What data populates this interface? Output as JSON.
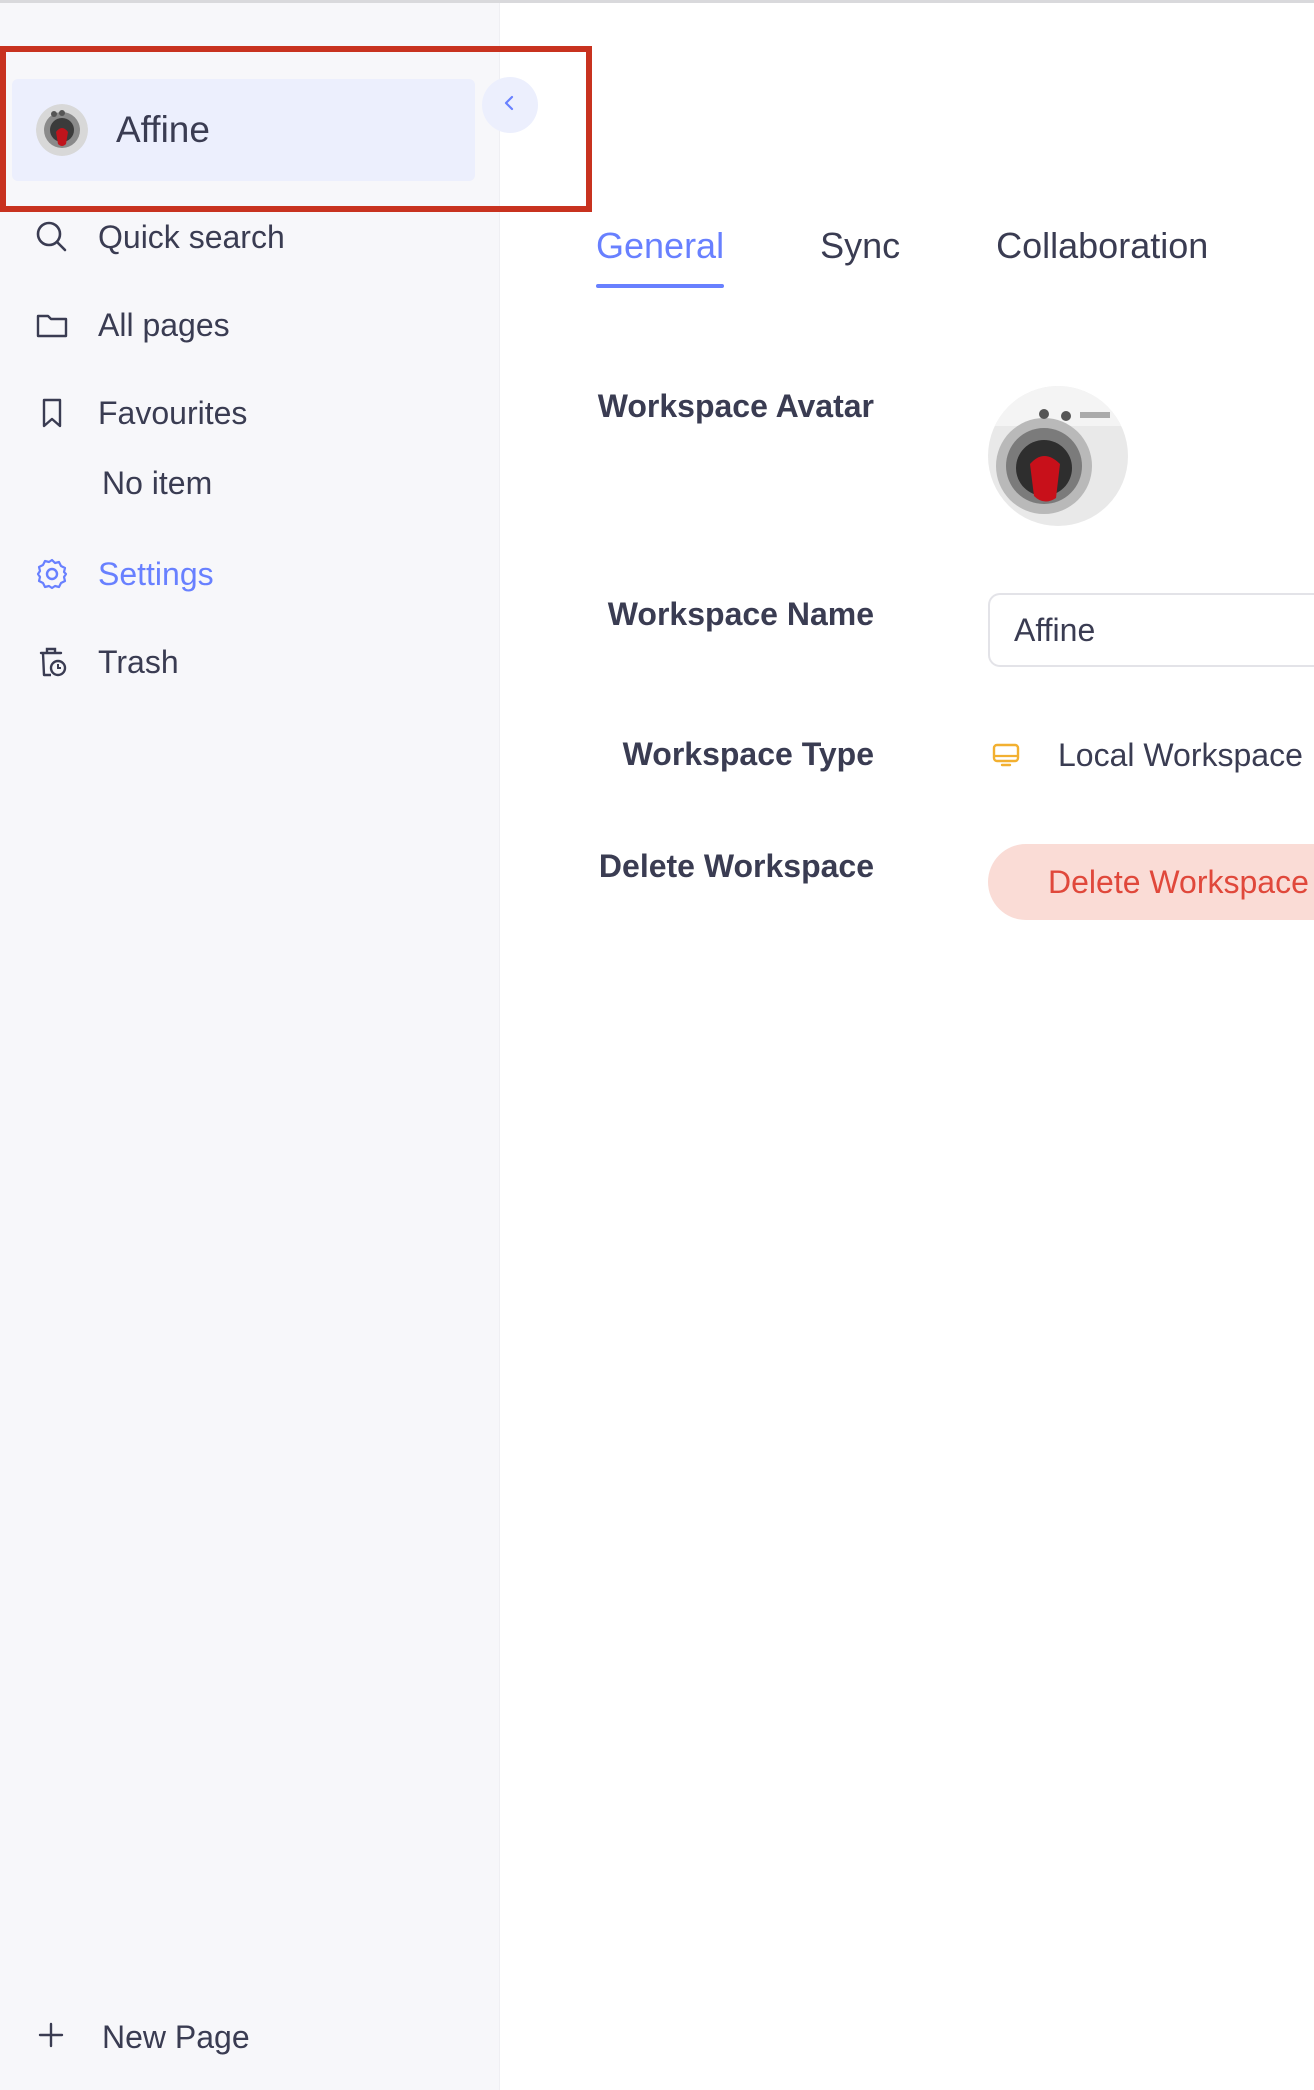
{
  "workspace": {
    "name": "Affine"
  },
  "sidebar": {
    "items": [
      {
        "label": "Quick search",
        "icon": "search-icon"
      },
      {
        "label": "All pages",
        "icon": "folder-icon"
      },
      {
        "label": "Favourites",
        "icon": "bookmark-icon"
      },
      {
        "label": "Settings",
        "icon": "gear-icon",
        "active": true
      },
      {
        "label": "Trash",
        "icon": "trash-icon"
      }
    ],
    "favourites_empty": "No item",
    "new_page_label": "New Page"
  },
  "tabs": [
    {
      "label": "General",
      "active": true
    },
    {
      "label": "Sync",
      "active": false
    },
    {
      "label": "Collaboration",
      "active": false
    }
  ],
  "general": {
    "avatar_label": "Workspace Avatar",
    "name_label": "Workspace Name",
    "name_value": "Affine",
    "type_label": "Workspace Type",
    "type_value": "Local Workspace",
    "delete_label": "Delete Workspace",
    "delete_button": "Delete Workspace"
  },
  "colors": {
    "accent": "#6880ff",
    "danger_text": "#e0483b",
    "danger_bg": "#fadcd6",
    "type_icon": "#f2b030",
    "highlight": "#c8321f"
  }
}
